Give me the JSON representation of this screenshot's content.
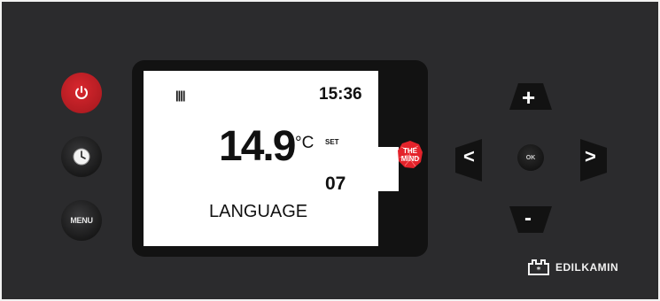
{
  "display": {
    "time": "15:36",
    "temperature": "14.9",
    "unit": "°C",
    "set_label": "SET",
    "set_value": "07",
    "menu_text": "LANGUAGE",
    "signal_icon": "bars-icon"
  },
  "buttons": {
    "power_icon": "power-icon",
    "clock_icon": "clock-icon",
    "menu_label": "MENU",
    "ok_label": "OK",
    "plus_symbol": "+",
    "minus_symbol": "-",
    "left_symbol": "<",
    "right_symbol": ">"
  },
  "badge": {
    "line1": "THE",
    "line2": "MIND"
  },
  "brand": {
    "name": "EDILKAMIN"
  },
  "colors": {
    "panel": "#2b2b2d",
    "power_red": "#c8232a",
    "badge_red": "#e3232b"
  }
}
